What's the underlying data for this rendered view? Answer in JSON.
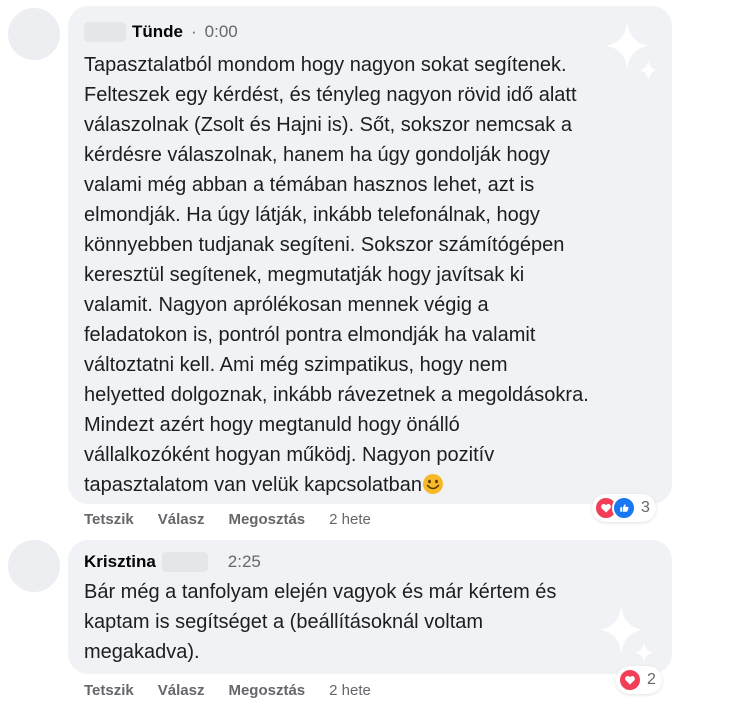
{
  "colors": {
    "bubble_bg": "#f0f2f5",
    "secondary_text": "#65676b",
    "love": "#f33e58",
    "like": "#1877f2",
    "emoji": "#f7b928"
  },
  "comments": [
    {
      "author": "Tünde",
      "separator": "·",
      "timestamp": "0:00",
      "text": "Tapasztalatból mondom hogy nagyon sokat segítenek.\nFelteszek egy kérdést, és tényleg nagyon rövid idő alatt\nválaszolnak (Zsolt és Hajni is). Sőt, sokszor nemcsak a\nkérdésre válaszolnak, hanem ha úgy gondolják hogy\nvalami még abban a témában hasznos lehet, azt is\nelmondják. Ha úgy látják, inkább telefonálnak, hogy\nkönnyebben tudjanak segíteni. Sokszor számítógépen\nkeresztül segítenek, megmutatják hogy javítsak ki\nvalamit. Nagyon aprólékosan mennek végig a\nfeladatokon is, pontról pontra elmondják ha valamit\nváltoztatni kell. Ami még szimpatikus, hogy nem\nhelyetted dolgoznak, inkább rávezetnek a megoldásokra.\nMindezt azért hogy megtanuld hogy önálló\nvállalkozóként hogyan működj. Nagyon pozitív\ntapasztalatom van velük kapcsolatban",
      "emoji": "smiling-face-emoji",
      "reactions": [
        "love",
        "like"
      ],
      "reaction_count": "3",
      "actions": {
        "like": "Tetszik",
        "reply": "Válasz",
        "share": "Megosztás",
        "age": "2 hete"
      }
    },
    {
      "author": "Krisztina",
      "timestamp": "2:25",
      "text": "Bár még a tanfolyam elején vagyok és már kértem és\nkaptam is segítséget a (beállításoknál voltam\nmegakadva).",
      "reactions": [
        "love"
      ],
      "reaction_count": "2",
      "actions": {
        "like": "Tetszik",
        "reply": "Válasz",
        "share": "Megosztás",
        "age": "2 hete"
      }
    }
  ]
}
